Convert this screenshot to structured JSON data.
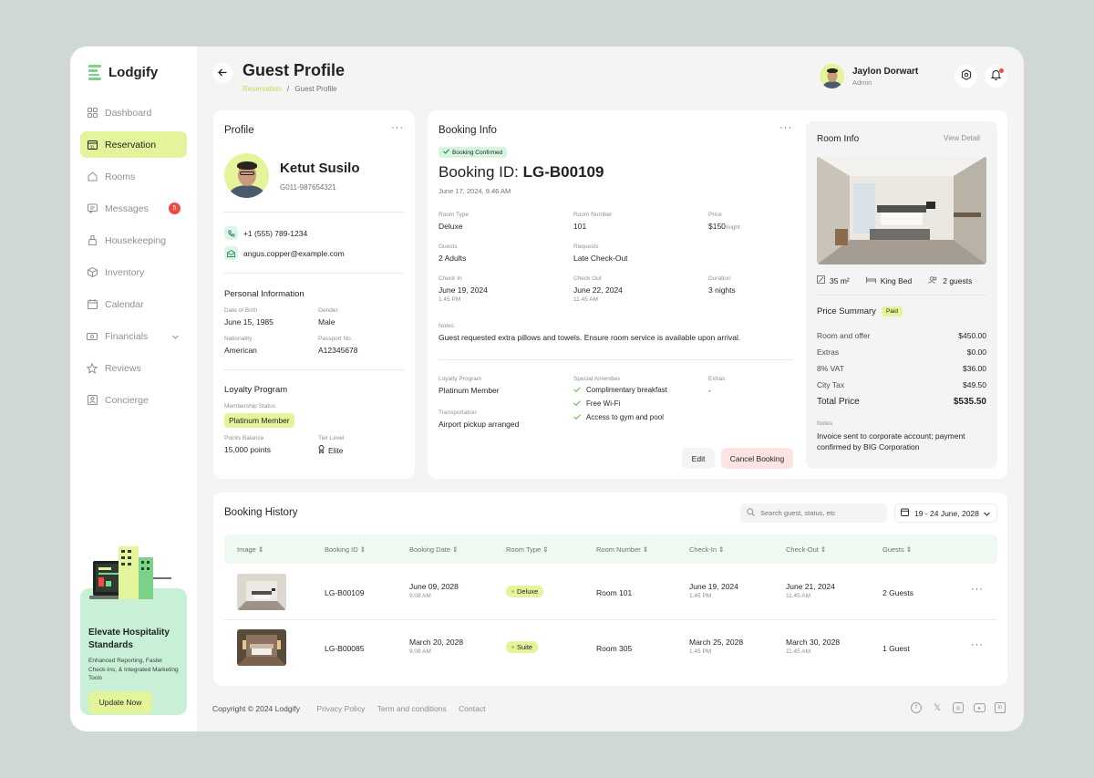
{
  "app": {
    "name": "Lodgify"
  },
  "sidebar": {
    "items": [
      {
        "label": "Dashboard",
        "icon": "grid-icon"
      },
      {
        "label": "Reservation",
        "icon": "calendar-31-icon",
        "active": true
      },
      {
        "label": "Rooms",
        "icon": "home-icon"
      },
      {
        "label": "Messages",
        "icon": "message-icon",
        "badge": "5"
      },
      {
        "label": "Housekeeping",
        "icon": "brush-icon"
      },
      {
        "label": "Inventory",
        "icon": "box-icon"
      },
      {
        "label": "Calendar",
        "icon": "calendar-icon"
      },
      {
        "label": "Financials",
        "icon": "money-icon",
        "has_chevron": true
      },
      {
        "label": "Reviews",
        "icon": "star-icon"
      },
      {
        "label": "Concierge",
        "icon": "concierge-icon"
      }
    ],
    "promo": {
      "title": "Elevate Hospitality Standards",
      "text": "Enhanced Reporting, Faster Check-Ins, & Integrated Marketing Tools",
      "button": "Update Now"
    }
  },
  "header": {
    "title": "Guest Profile",
    "breadcrumb": [
      "Reservation",
      "Guest Profile"
    ],
    "breadcrumb_sep": "/",
    "user": {
      "name": "Jaylon Dorwart",
      "role": "Admin"
    }
  },
  "profile": {
    "card_title": "Profile",
    "name": "Ketut Susilo",
    "guest_id": "G011-987654321",
    "phone": "+1 (555) 789-1234",
    "email": "angus.copper@example.com",
    "personal": {
      "title": "Personal Information",
      "fields": [
        {
          "label": "Date of Birth",
          "value": "June 15, 1985"
        },
        {
          "label": "Gender",
          "value": "Male"
        },
        {
          "label": "Nationality",
          "value": "American"
        },
        {
          "label": "Passport No.",
          "value": "A12345678"
        }
      ]
    },
    "loyalty": {
      "title": "Loyalty Program",
      "status_label": "Membership Status",
      "status_value": "Platinum Member",
      "points_label": "Points Balance",
      "points_value": "15,000 points",
      "tier_label": "Tier Level",
      "tier_value": "Elite"
    }
  },
  "booking": {
    "card_title": "Booking Info",
    "status_badge": "Booking Confirmed",
    "id_prefix": "Booking ID:",
    "id": "LG-B00109",
    "datetime": "June 17, 2024, 9.46 AM",
    "room_type_label": "Room Type",
    "room_type": "Deluxe",
    "room_number_label": "Room Number",
    "room_number": "101",
    "price_label": "Price",
    "price": "$150",
    "price_unit": "/night",
    "guests_label": "Guests",
    "guests": "2 Adults",
    "requests_label": "Requests",
    "requests": "Late Check-Out",
    "checkin_label": "Check In",
    "checkin_date": "June 19, 2024",
    "checkin_time": "1.45 PM",
    "checkout_label": "Check Out",
    "checkout_date": "June 22, 2024",
    "checkout_time": "11.45 AM",
    "duration_label": "Duration",
    "duration": "3 nights",
    "notes_label": "Notes",
    "notes": "Guest requested extra pillows and towels. Ensure room service is available upon arrival.",
    "loyalty_label": "Loyalty Program",
    "loyalty": "Platinum Member",
    "transport_label": "Transportation",
    "transport": "Airport pickup arranged",
    "amenities_label": "Special Amenities",
    "amenities": [
      "Complimentary breakfast",
      "Free Wi-Fi",
      "Access to gym and pool"
    ],
    "extras_label": "Extras",
    "extras": "-",
    "edit_button": "Edit",
    "cancel_button": "Cancel Booking"
  },
  "room": {
    "card_title": "Room Info",
    "view_detail": "View Detail",
    "size": "35 m²",
    "bed": "King Bed",
    "capacity": "2 guests",
    "price_summary_title": "Price Summary",
    "paid_badge": "Paid",
    "lines": [
      {
        "label": "Room and offer",
        "value": "$450.00"
      },
      {
        "label": "Extras",
        "value": "$0.00"
      },
      {
        "label": "8% VAT",
        "value": "$36.00"
      },
      {
        "label": "City Tax",
        "value": "$49.50"
      }
    ],
    "total_label": "Total Price",
    "total_value": "$535.50",
    "notes_label": "Notes",
    "notes": "Invoice sent to corporate account; payment confirmed by BIG Corporation"
  },
  "history": {
    "title": "Booking History",
    "search_placeholder": "Search guest, status, etc",
    "date_range": "19 - 24 June, 2028",
    "columns": [
      "Image",
      "Booking ID",
      "Booking Date",
      "Room Type",
      "Room Number",
      "Check-In",
      "Check-Out",
      "Guests"
    ],
    "rows": [
      {
        "booking_id": "LG-B00109",
        "booking_date": "June 09, 2028",
        "booking_time": "9.08 AM",
        "room_type": "Deluxe",
        "room_number": "Room 101",
        "checkin_date": "June 19, 2024",
        "checkin_time": "1.45 PM",
        "checkout_date": "June 21, 2024",
        "checkout_time": "11.45 AM",
        "guests": "2 Guests"
      },
      {
        "booking_id": "LG-B00085",
        "booking_date": "March 20, 2028",
        "booking_time": "9.08 AM",
        "room_type": "Suite",
        "room_number": "Room 305",
        "checkin_date": "March 25, 2028",
        "checkin_time": "1.45 PM",
        "checkout_date": "March 30, 2028",
        "checkout_time": "11.45 AM",
        "guests": "1 Guest"
      }
    ]
  },
  "footer": {
    "copyright": "Copyright © 2024 Lodgify",
    "links": [
      "Privacy Policy",
      "Term and conditions",
      "Contact"
    ],
    "social": [
      "facebook-icon",
      "x-icon",
      "instagram-icon",
      "youtube-icon",
      "linkedin-icon"
    ]
  },
  "colors": {
    "accent": "#e3f49a",
    "mint": "#c8f0d6",
    "danger": "#f04a43",
    "background": "#cfd8d3"
  }
}
